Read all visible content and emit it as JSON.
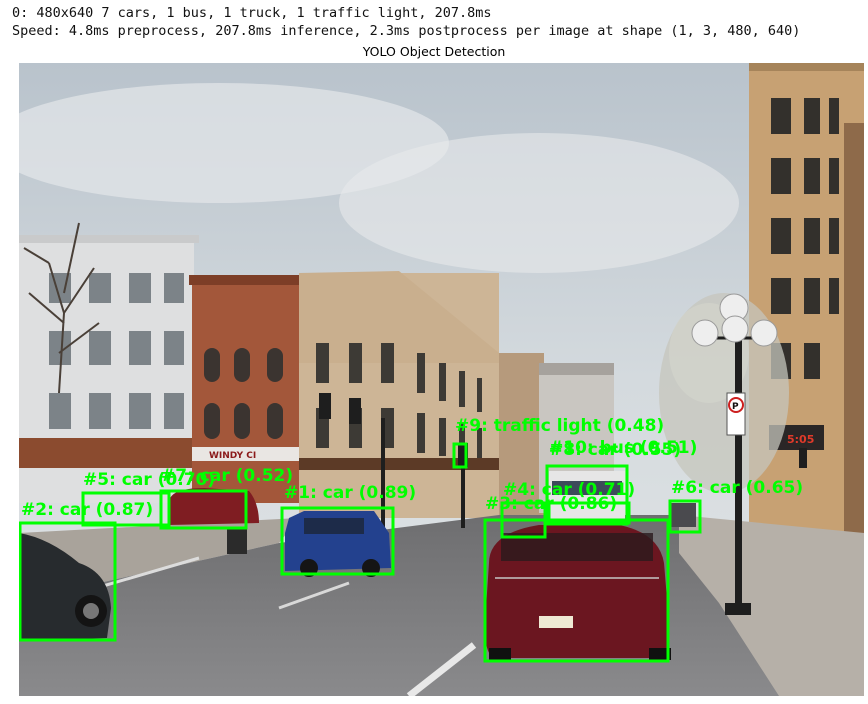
{
  "console": {
    "line1": "0: 480x640 7 cars, 1 bus, 1 truck, 1 traffic light, 207.8ms",
    "line2": "Speed: 4.8ms preprocess, 207.8ms inference, 2.3ms postprocess per image at shape (1, 3, 480, 640)"
  },
  "figure": {
    "title": "YOLO Object Detection",
    "box_color": "#00ff00",
    "detections": [
      {
        "id": "1",
        "label": "#1: car (0.89)"
      },
      {
        "id": "2",
        "label": "#2: car (0.87)"
      },
      {
        "id": "3",
        "label": "#3: car (0.86)"
      },
      {
        "id": "4",
        "label": "#4: car (0.71)"
      },
      {
        "id": "5",
        "label": "#5: car (0.70)"
      },
      {
        "id": "6",
        "label": "#6: car (0.65)"
      },
      {
        "id": "7",
        "label": "#7: car (0.52)"
      },
      {
        "id": "8",
        "label": "#8: car (0.55)"
      },
      {
        "id": "9",
        "label": "#9: traffic light (0.48)"
      },
      {
        "id": "10",
        "label": "#10: bus (0.51)"
      }
    ],
    "signs": {
      "shop_sign": "WINDY CI",
      "no_parking": "P",
      "clock": "5:05"
    }
  }
}
